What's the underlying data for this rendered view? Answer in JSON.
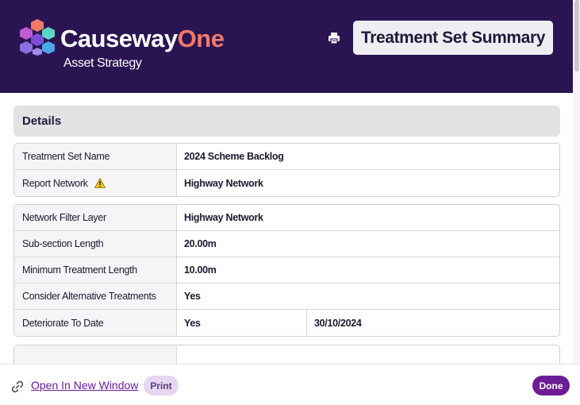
{
  "header": {
    "brand_prefix": "Causeway",
    "brand_suffix": "One",
    "subtitle": "Asset Strategy",
    "title": "Treatment Set Summary",
    "icons": {
      "logo": "causeway-cube-logo",
      "print": "print-icon"
    }
  },
  "details": {
    "heading": "Details",
    "group1": [
      {
        "label": "Treatment Set Name",
        "value": "2024 Scheme Backlog"
      },
      {
        "label": "Report Network",
        "value": "Highway Network",
        "icon": "warning-icon"
      }
    ],
    "group2": [
      {
        "label": "Network Filter Layer",
        "value": "Highway Network"
      },
      {
        "label": "Sub-section Length",
        "value": "20.00m"
      },
      {
        "label": "Minimum Treatment Length",
        "value": "10.00m"
      },
      {
        "label": "Consider Alternative Treatments",
        "value": "Yes"
      },
      {
        "label": "Deteriorate To Date",
        "value": "Yes",
        "value2": "30/10/2024"
      }
    ]
  },
  "footer": {
    "open_link": "Open In New Window",
    "print_label": "Print",
    "done_label": "Done"
  },
  "colors": {
    "header_bg": "#2a1452",
    "brand_accent": "#f37a6a",
    "primary": "#6c1c94",
    "print_btn_bg": "#e6d6f2"
  }
}
